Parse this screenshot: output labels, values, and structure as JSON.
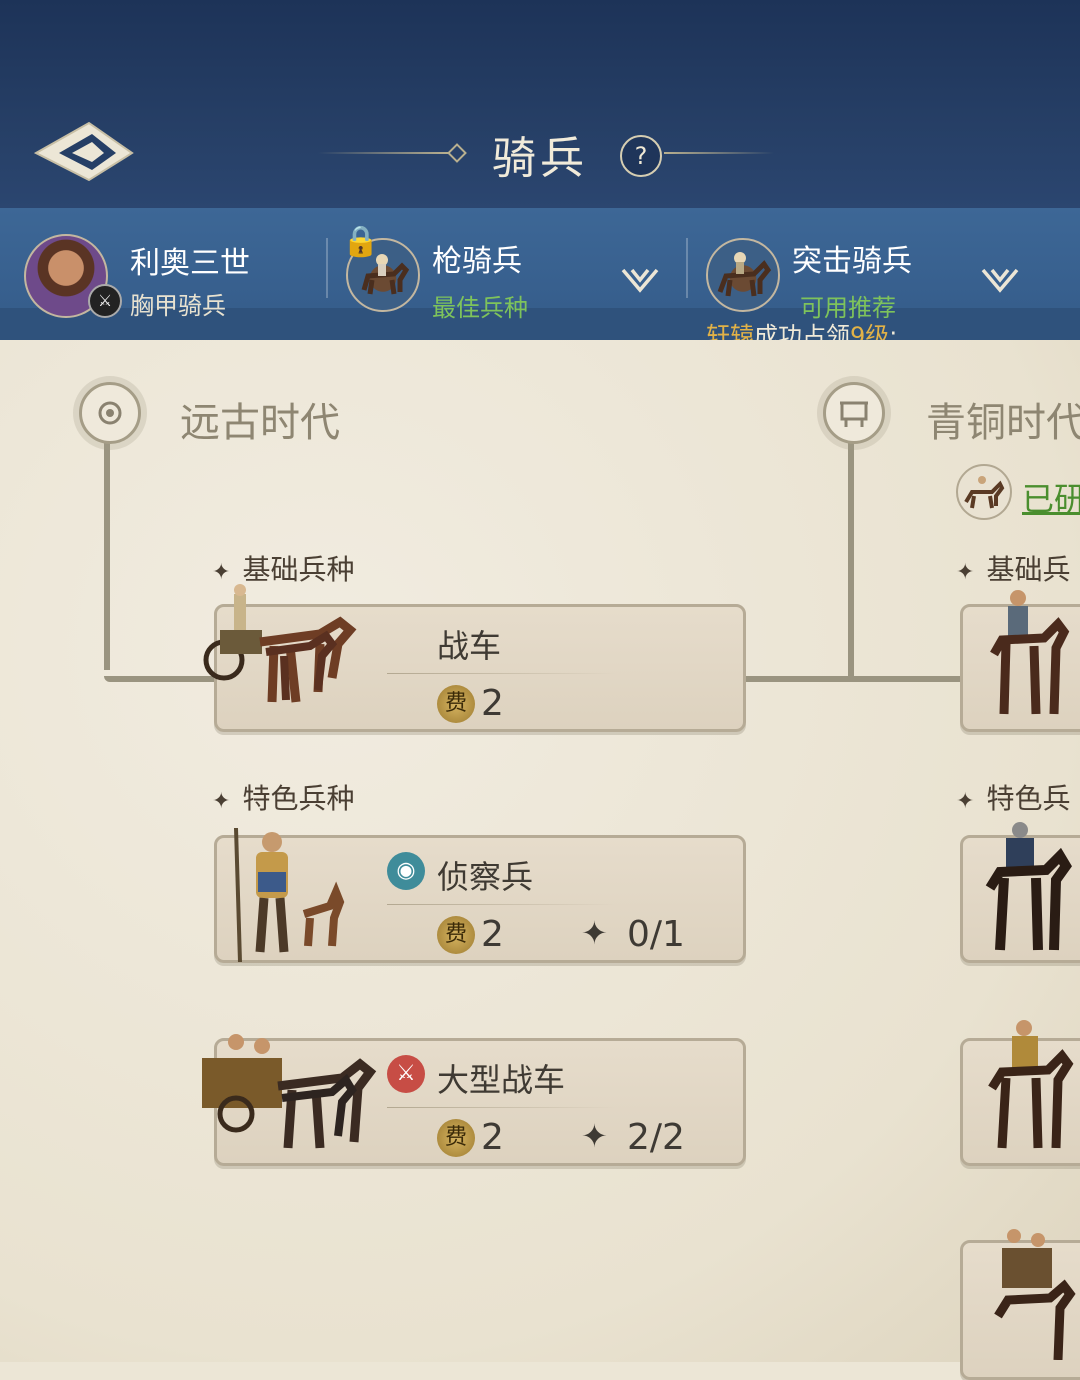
{
  "header": {
    "title": "骑兵",
    "help_label": "?"
  },
  "unit_bar": {
    "hero": {
      "name": "利奥三世",
      "unit": "胸甲骑兵"
    },
    "slot2": {
      "name": "枪骑兵",
      "tag": "最佳兵种"
    },
    "slot3": {
      "name": "突击骑兵",
      "tag": "可用推荐"
    },
    "notice": {
      "player": "轩辕",
      "text": "成功占领",
      "level": "9级",
      "tail": ":"
    }
  },
  "eras": [
    {
      "title": "远古时代"
    },
    {
      "title": "青铜时代"
    }
  ],
  "bronze_status": "已研",
  "sections": {
    "basic": "基础兵种",
    "special": "特色兵种",
    "basic_right": "基础兵",
    "special_right": "特色兵"
  },
  "cards": [
    {
      "name": "战车",
      "cost_label": "费",
      "cost": "2",
      "progress": ""
    },
    {
      "name": "侦察兵",
      "cost_label": "费",
      "cost": "2",
      "progress": "0/1",
      "type_icon": "eye-icon"
    },
    {
      "name": "大型战车",
      "cost_label": "费",
      "cost": "2",
      "progress": "2/2",
      "type_icon": "sword-icon"
    }
  ],
  "colors": {
    "header_bg": "#1d3358",
    "unitbar_bg": "#3d6796",
    "parchment": "#ece6d6",
    "green_text": "#7ec35b",
    "gold_text": "#e2b247"
  }
}
